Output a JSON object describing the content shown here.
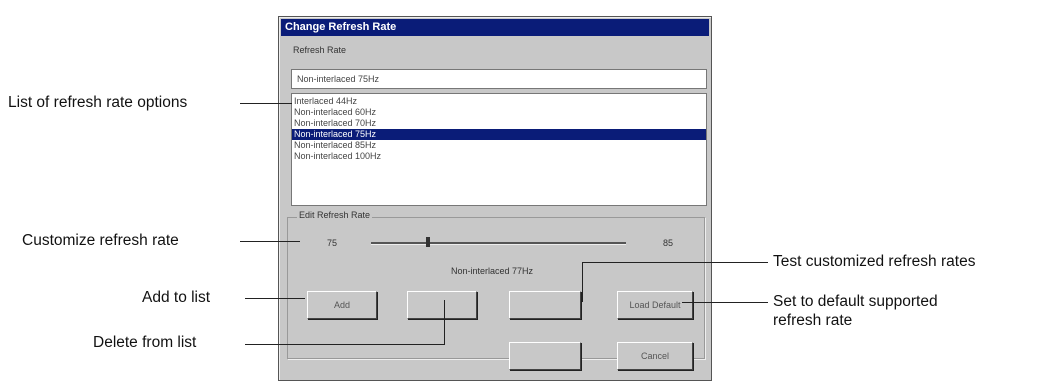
{
  "dialog": {
    "title": "Change Refresh Rate",
    "refresh_rate_label": "Refresh Rate",
    "current_value": "Non-interlaced 75Hz",
    "options": [
      "Interlaced 44Hz",
      "Non-interlaced 60Hz",
      "Non-interlaced 70Hz",
      "Non-interlaced 75Hz",
      "Non-interlaced 85Hz",
      "Non-interlaced 100Hz"
    ],
    "selected_index": 3,
    "edit_group_label": "Edit Refresh Rate",
    "slider_min": "75",
    "slider_max": "85",
    "slider_value_text": "Non-interlaced 77Hz",
    "buttons": {
      "add": "Add",
      "delete": "",
      "test": "",
      "load_default": "Load Default",
      "ok": "",
      "cancel": "Cancel"
    }
  },
  "callouts": {
    "list_options": "List of refresh rate options",
    "customize": "Customize refresh rate",
    "add": "Add to list",
    "delete": "Delete from list",
    "test": "Test customized refresh rates",
    "default_line1": "Set to default supported",
    "default_line2": "refresh rate"
  }
}
